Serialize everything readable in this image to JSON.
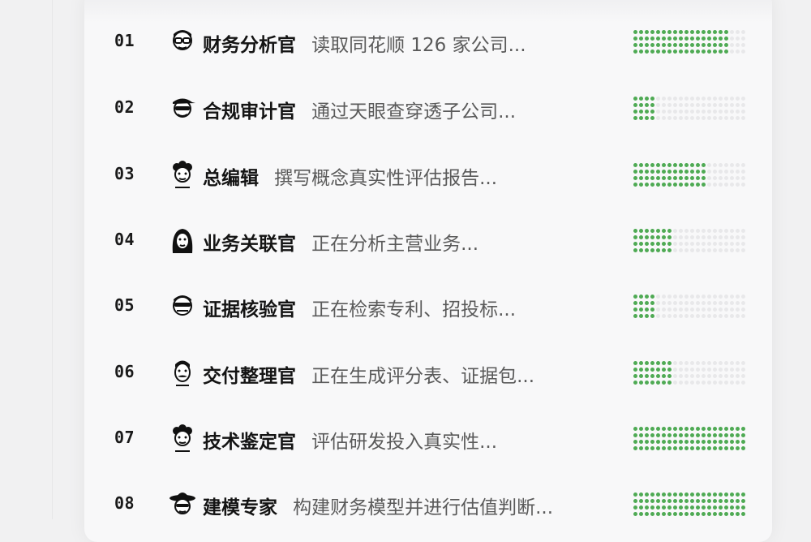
{
  "agents": [
    {
      "index": "01",
      "name": "财务分析官",
      "desc": "读取同花顺 126 家公司...",
      "progress": 0.85,
      "avatar_icon": "glasses-man-icon"
    },
    {
      "index": "02",
      "name": "合规审计官",
      "desc": "通过天眼查穿透子公司...",
      "progress": 0.2,
      "avatar_icon": "sunglasses-cap-man-icon"
    },
    {
      "index": "03",
      "name": "总编辑",
      "desc": "撰写概念真实性评估报告...",
      "progress": 0.65,
      "avatar_icon": "curly-hair-woman-icon"
    },
    {
      "index": "04",
      "name": "业务关联官",
      "desc": "正在分析主营业务...",
      "progress": 0.35,
      "avatar_icon": "long-hair-woman-icon"
    },
    {
      "index": "05",
      "name": "证据核验官",
      "desc": "正在检索专利、招投标...",
      "progress": 0.2,
      "avatar_icon": "masked-man-icon"
    },
    {
      "index": "06",
      "name": "交付整理官",
      "desc": "正在生成评分表、证据包...",
      "progress": 0.35,
      "avatar_icon": "mustache-man-icon"
    },
    {
      "index": "07",
      "name": "技术鉴定官",
      "desc": "评估研发投入真实性...",
      "progress": 1.0,
      "avatar_icon": "curly-hair-woman-icon"
    },
    {
      "index": "08",
      "name": "建模专家",
      "desc": "构建财务模型并进行估值判断...",
      "progress": 1.0,
      "avatar_icon": "cowboy-hat-man-icon"
    }
  ],
  "colors": {
    "progress_on": "#4faa54",
    "progress_off": "#e8e8ea",
    "text_primary": "#141414",
    "text_secondary": "#5a5a5a"
  }
}
